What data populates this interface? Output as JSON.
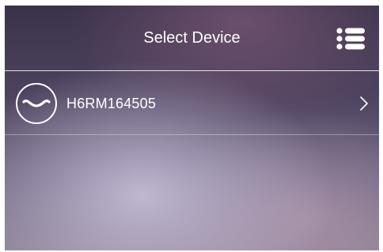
{
  "header": {
    "title": "Select Device",
    "menu_icon": "list-menu-icon"
  },
  "devices": [
    {
      "name": "H6RM164505",
      "icon": "device-wave-icon",
      "action_icon": "chevron-right-icon"
    }
  ],
  "colors": {
    "text": "#ffffff",
    "divider": "#ffffff"
  }
}
